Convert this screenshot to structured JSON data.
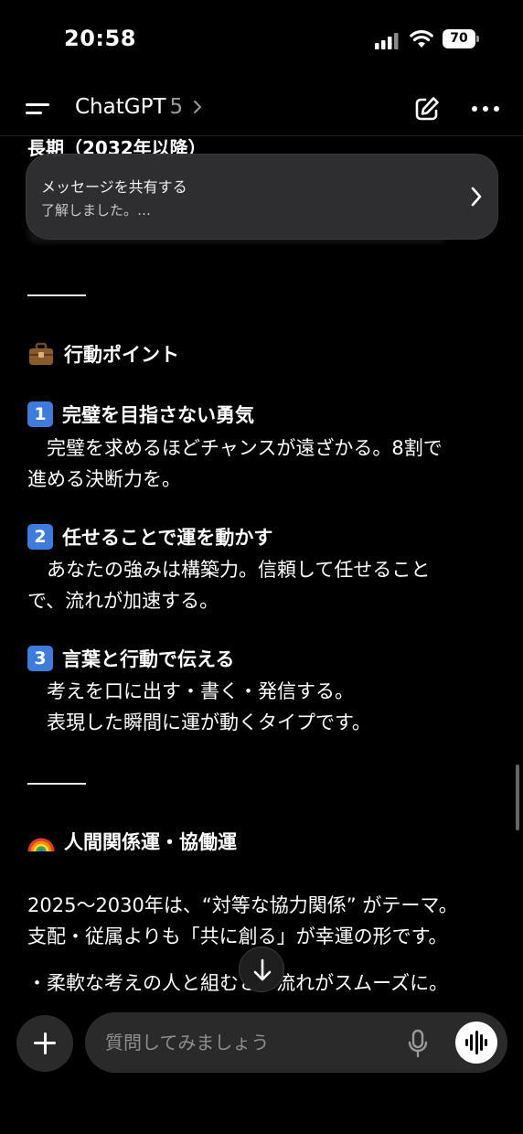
{
  "status_bar": {
    "time": "20:58",
    "battery": "70"
  },
  "header": {
    "title": "ChatGPT",
    "version": "5"
  },
  "toast": {
    "title": "メッセージを共有する",
    "subtitle": "了解しました。…"
  },
  "content": {
    "partial_heading": "長期（2032年以降）",
    "action_heading": "行動ポイント",
    "points": [
      {
        "num": "1",
        "title": "完璧を目指さない勇気",
        "body": "　完璧を求めるほどチャンスが遠ざかる。8割で\n進める決断力を。"
      },
      {
        "num": "2",
        "title": "任せることで運を動かす",
        "body": "　あなたの強みは構築力。信頼して任せること\nで、流れが加速する。"
      },
      {
        "num": "3",
        "title": "言葉と行動で伝える",
        "body": "　考えを口に出す・書く・発信する。\n　表現した瞬間に運が動くタイプです。"
      }
    ],
    "relation_heading": "人間関係運・協働運",
    "relation_body": "2025～2030年は、“対等な協力関係” がテーマ。\n支配・従属よりも「共に創る」が幸運の形です。",
    "bullet_partial": "・柔軟な考えの人と組むと、流れがスムーズに。"
  },
  "composer": {
    "placeholder": "質問してみましょう"
  },
  "icons": {
    "menu": "menu-icon",
    "edit": "edit-icon",
    "more": "more-icon",
    "briefcase": "briefcase-icon",
    "rainbow": "rainbow-icon",
    "plus": "plus-icon",
    "mic": "mic-icon",
    "voice": "voice-mode-icon",
    "arrow_down": "arrow-down-icon"
  },
  "colors": {
    "background": "#000000",
    "number_badge": "#3d7bdc",
    "surface": "#2a2a2a"
  }
}
